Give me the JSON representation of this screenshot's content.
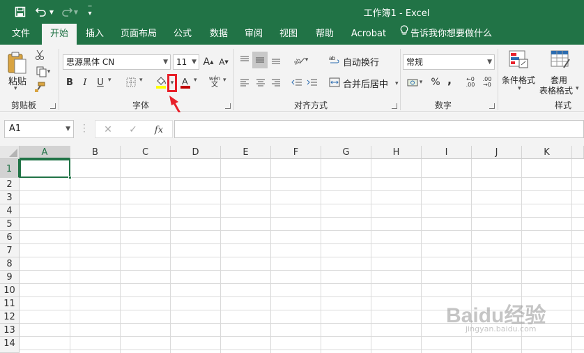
{
  "title_bar": {
    "title": "工作簿1  -  Excel",
    "save_icon": "save-icon",
    "undo_icon": "undo-icon",
    "redo_icon": "redo-icon"
  },
  "tabs": [
    {
      "label": "文件"
    },
    {
      "label": "开始"
    },
    {
      "label": "插入"
    },
    {
      "label": "页面布局"
    },
    {
      "label": "公式"
    },
    {
      "label": "数据"
    },
    {
      "label": "审阅"
    },
    {
      "label": "视图"
    },
    {
      "label": "帮助"
    },
    {
      "label": "Acrobat"
    },
    {
      "label": "告诉我你想要做什么"
    }
  ],
  "ribbon": {
    "clipboard": {
      "paste_label": "粘贴",
      "group_label": "剪贴板"
    },
    "font": {
      "font_name": "思源黑体 CN",
      "font_size": "11",
      "bold": "B",
      "italic": "I",
      "underline": "U",
      "fill_color": "#ffff00",
      "font_color": "#c00000",
      "group_label": "字体"
    },
    "alignment": {
      "wrap_text": "自动换行",
      "merge_center": "合并后居中",
      "group_label": "对齐方式"
    },
    "number": {
      "format": "常规",
      "percent": "%",
      "comma": ",",
      "group_label": "数字"
    },
    "styles": {
      "conditional_format": "条件格式",
      "table_format_1": "套用",
      "table_format_2": "表格格式",
      "group_label": "样式"
    }
  },
  "formula_bar": {
    "name_box": "A1",
    "cancel": "✕",
    "enter": "✓",
    "fx": "fx",
    "value": ""
  },
  "grid": {
    "columns": [
      "A",
      "B",
      "C",
      "D",
      "E",
      "F",
      "G",
      "H",
      "I",
      "J",
      "K"
    ],
    "rows": [
      "1",
      "2",
      "3",
      "4",
      "5",
      "6",
      "7",
      "8",
      "9",
      "10",
      "11",
      "12",
      "13",
      "14"
    ],
    "selected_cell": "A1"
  },
  "colors": {
    "excel_green": "#217346",
    "annotation_red": "#e8202a"
  },
  "watermark": {
    "text": "Baidu经验",
    "sub": "jingyan.baidu.com"
  }
}
